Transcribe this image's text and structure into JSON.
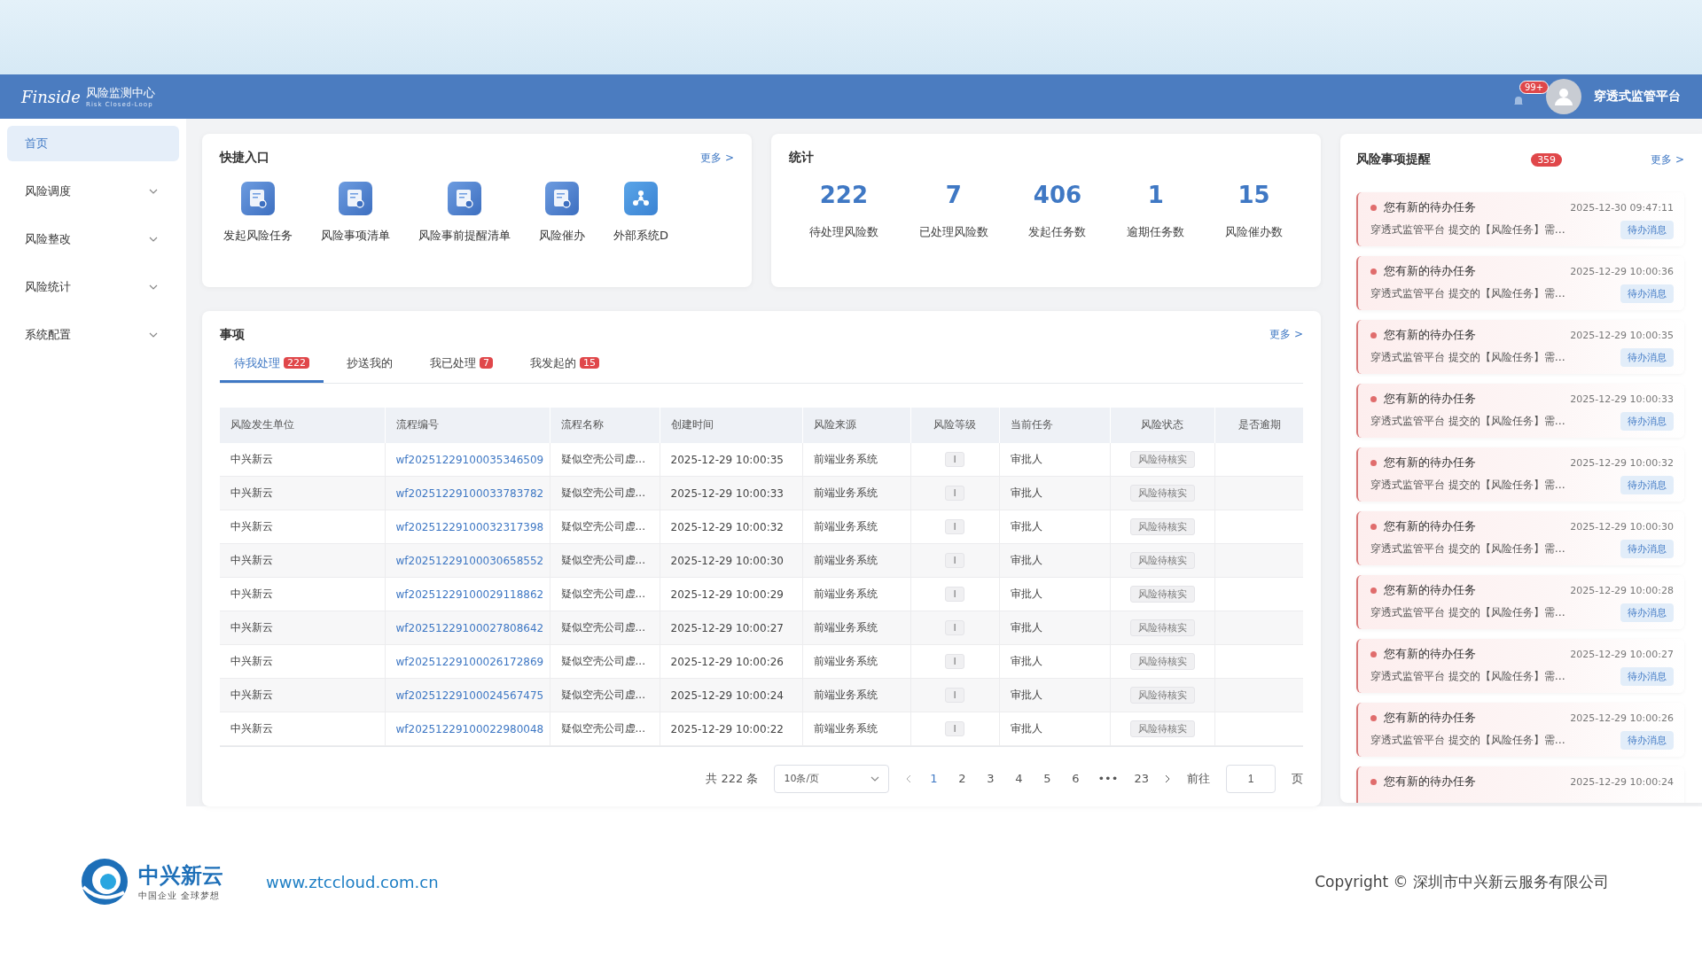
{
  "header": {
    "logo_text": "Finside",
    "app_title": "风险监测中心",
    "app_subtitle": "Risk Closed-Loop",
    "notification_badge": "99+",
    "user_name": "穿透式监管平台"
  },
  "sidebar": {
    "items": [
      {
        "label": "首页",
        "selected": true,
        "expandable": false
      },
      {
        "label": "风险调度",
        "selected": false,
        "expandable": true
      },
      {
        "label": "风险整改",
        "selected": false,
        "expandable": true
      },
      {
        "label": "风险统计",
        "selected": false,
        "expandable": true
      },
      {
        "label": "系统配置",
        "selected": false,
        "expandable": true
      }
    ]
  },
  "quick_entry": {
    "title": "快捷入口",
    "more": "更多 >",
    "items": [
      {
        "label": "发起风险任务",
        "kind": "document"
      },
      {
        "label": "风险事项清单",
        "kind": "document"
      },
      {
        "label": "风险事前提醒清单",
        "kind": "document"
      },
      {
        "label": "风险催办",
        "kind": "document"
      },
      {
        "label": "外部系统D",
        "kind": "network"
      }
    ]
  },
  "stats": {
    "title": "统计",
    "items": [
      {
        "value": "222",
        "label": "待处理风险数"
      },
      {
        "value": "7",
        "label": "已处理风险数"
      },
      {
        "value": "406",
        "label": "发起任务数"
      },
      {
        "value": "1",
        "label": "逾期任务数"
      },
      {
        "value": "15",
        "label": "风险催办数"
      }
    ]
  },
  "matters": {
    "title": "事项",
    "more": "更多 >",
    "tabs": [
      {
        "label": "待我处理",
        "badge": "222",
        "selected": true
      },
      {
        "label": "抄送我的",
        "selected": false
      },
      {
        "label": "我已处理",
        "badge": "7",
        "selected": false
      },
      {
        "label": "我发起的",
        "badge": "15",
        "selected": false
      }
    ],
    "table": {
      "columns": [
        "风险发生单位",
        "流程编号",
        "流程名称",
        "创建时间",
        "风险来源",
        "风险等级",
        "当前任务",
        "风险状态",
        "是否逾期"
      ],
      "rows": [
        [
          "中兴新云",
          "wf20251229100035346509",
          "疑似空壳公司虚...",
          "2025-12-29 10:00:35",
          "前端业务系统",
          "I",
          "审批人",
          "风险待核实"
        ],
        [
          "中兴新云",
          "wf20251229100033783782",
          "疑似空壳公司虚...",
          "2025-12-29 10:00:33",
          "前端业务系统",
          "I",
          "审批人",
          "风险待核实"
        ],
        [
          "中兴新云",
          "wf20251229100032317398",
          "疑似空壳公司虚...",
          "2025-12-29 10:00:32",
          "前端业务系统",
          "I",
          "审批人",
          "风险待核实"
        ],
        [
          "中兴新云",
          "wf20251229100030658552",
          "疑似空壳公司虚...",
          "2025-12-29 10:00:30",
          "前端业务系统",
          "I",
          "审批人",
          "风险待核实"
        ],
        [
          "中兴新云",
          "wf20251229100029118862",
          "疑似空壳公司虚...",
          "2025-12-29 10:00:29",
          "前端业务系统",
          "I",
          "审批人",
          "风险待核实"
        ],
        [
          "中兴新云",
          "wf20251229100027808642",
          "疑似空壳公司虚...",
          "2025-12-29 10:00:27",
          "前端业务系统",
          "I",
          "审批人",
          "风险待核实"
        ],
        [
          "中兴新云",
          "wf20251229100026172869",
          "疑似空壳公司虚...",
          "2025-12-29 10:00:26",
          "前端业务系统",
          "I",
          "审批人",
          "风险待核实"
        ],
        [
          "中兴新云",
          "wf20251229100024567475",
          "疑似空壳公司虚...",
          "2025-12-29 10:00:24",
          "前端业务系统",
          "I",
          "审批人",
          "风险待核实"
        ],
        [
          "中兴新云",
          "wf20251229100022980048",
          "疑似空壳公司虚...",
          "2025-12-29 10:00:22",
          "前端业务系统",
          "I",
          "审批人",
          "风险待核实"
        ]
      ]
    },
    "pagination": {
      "total": "共 222 条",
      "page_size": "10条/页",
      "pages": [
        {
          "label": "1",
          "selected": true
        },
        {
          "label": "2",
          "selected": false
        },
        {
          "label": "3",
          "selected": false
        },
        {
          "label": "4",
          "selected": false
        },
        {
          "label": "5",
          "selected": false
        },
        {
          "label": "6",
          "selected": false
        },
        {
          "label": "•••",
          "selected": false
        },
        {
          "label": "23",
          "selected": false
        }
      ],
      "goto_label": "前往",
      "goto_value": "1",
      "page_unit": "页"
    }
  },
  "reminders": {
    "title": "风险事项提醒",
    "count": "359",
    "more": "更多 >",
    "items": [
      {
        "title": "您有新的待办任务",
        "time": "2025-12-30 09:47:11",
        "desc": "穿透式监管平台 提交的【风险任务】需…",
        "tag": "待办消息"
      },
      {
        "title": "您有新的待办任务",
        "time": "2025-12-29 10:00:36",
        "desc": "穿透式监管平台 提交的【风险任务】需…",
        "tag": "待办消息"
      },
      {
        "title": "您有新的待办任务",
        "time": "2025-12-29 10:00:35",
        "desc": "穿透式监管平台 提交的【风险任务】需…",
        "tag": "待办消息"
      },
      {
        "title": "您有新的待办任务",
        "time": "2025-12-29 10:00:33",
        "desc": "穿透式监管平台 提交的【风险任务】需…",
        "tag": "待办消息"
      },
      {
        "title": "您有新的待办任务",
        "time": "2025-12-29 10:00:32",
        "desc": "穿透式监管平台 提交的【风险任务】需…",
        "tag": "待办消息"
      },
      {
        "title": "您有新的待办任务",
        "time": "2025-12-29 10:00:30",
        "desc": "穿透式监管平台 提交的【风险任务】需…",
        "tag": "待办消息"
      },
      {
        "title": "您有新的待办任务",
        "time": "2025-12-29 10:00:28",
        "desc": "穿透式监管平台 提交的【风险任务】需…",
        "tag": "待办消息"
      },
      {
        "title": "您有新的待办任务",
        "time": "2025-12-29 10:00:27",
        "desc": "穿透式监管平台 提交的【风险任务】需…",
        "tag": "待办消息"
      },
      {
        "title": "您有新的待办任务",
        "time": "2025-12-29 10:00:26",
        "desc": "穿透式监管平台 提交的【风险任务】需…",
        "tag": "待办消息"
      },
      {
        "title": "您有新的待办任务",
        "time": "2025-12-29 10:00:24"
      }
    ]
  },
  "footer": {
    "brand": "中兴新云",
    "slogan": "中国企业 全球梦想",
    "url": "www.ztccloud.com.cn",
    "copyright": "Copyright © 深圳市中兴新云服务有限公司"
  }
}
